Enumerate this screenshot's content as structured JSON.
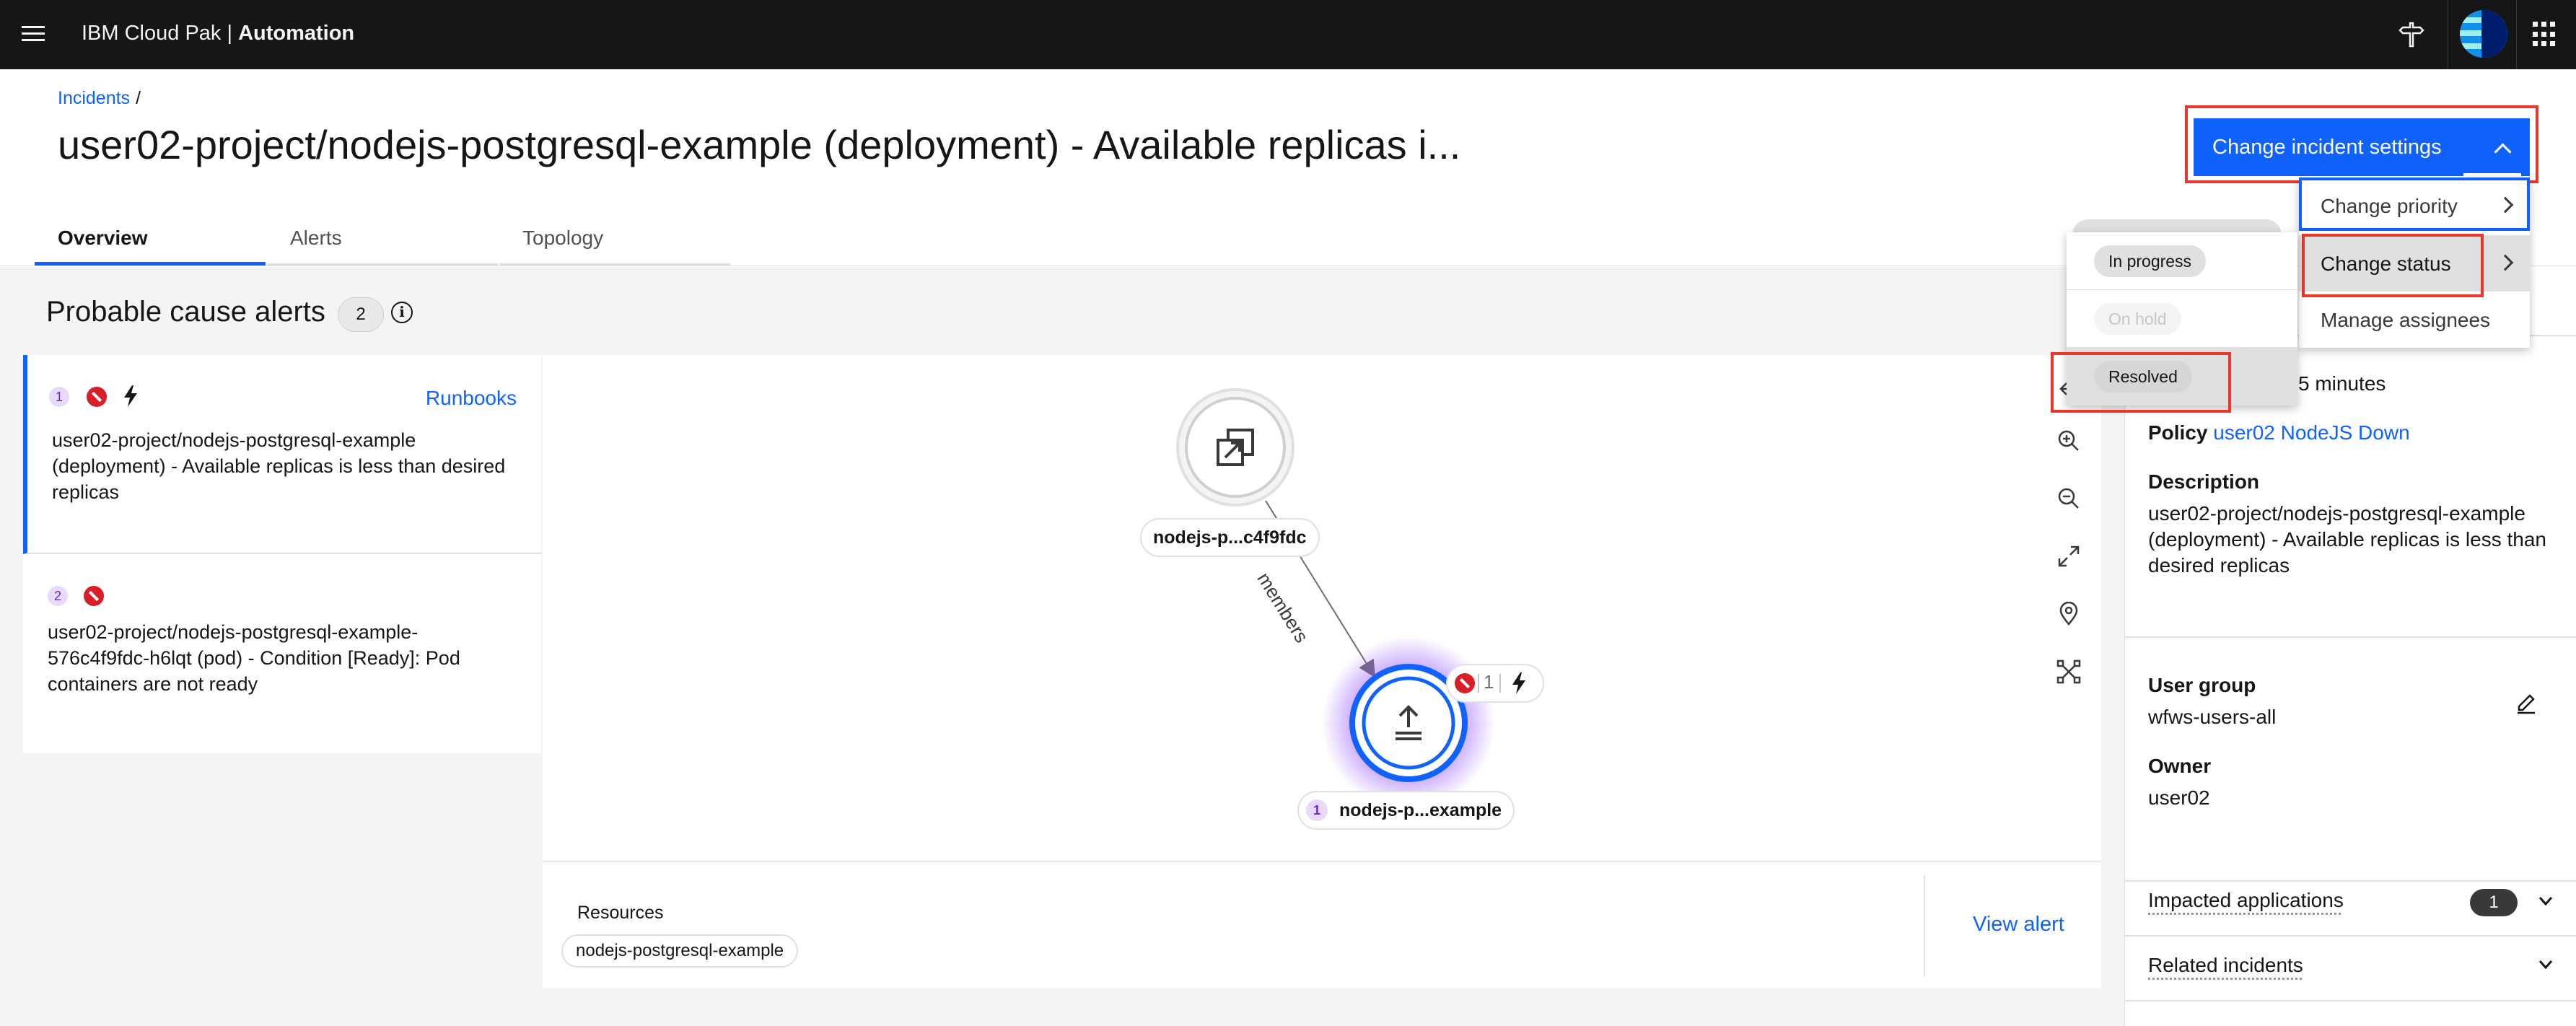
{
  "header": {
    "brand_prefix": "IBM Cloud Pak | ",
    "brand_product": "Automation"
  },
  "breadcrumb": {
    "incidents": "Incidents",
    "separator": "/"
  },
  "page_title": "user02-project/nodejs-postgresql-example (deployment) - Available replicas i...",
  "tabs": [
    {
      "label": "Overview",
      "active": true
    },
    {
      "label": "Alerts",
      "active": false
    },
    {
      "label": "Topology",
      "active": false
    }
  ],
  "settings_button": {
    "label": "Change incident settings"
  },
  "settings_menu": {
    "items": [
      {
        "label": "Change priority"
      },
      {
        "label": "Change status"
      },
      {
        "label": "Manage assignees"
      }
    ]
  },
  "status_submenu": {
    "items": [
      {
        "label": "In progress",
        "disabled": false
      },
      {
        "label": "On hold",
        "disabled": true
      },
      {
        "label": "Resolved",
        "disabled": false
      }
    ]
  },
  "probable_cause": {
    "title": "Probable cause alerts",
    "count": "2",
    "info": "i",
    "alerts": [
      {
        "rank": "1",
        "runbooks": "Runbooks",
        "text": "user02-project/nodejs-postgresql-example (deployment) - Available replicas is less than desired replicas"
      },
      {
        "rank": "2",
        "text": "user02-project/nodejs-postgresql-example-576c4f9fdc-h6lqt (pod) - Condition [Ready]: Pod containers are not ready"
      }
    ]
  },
  "topology": {
    "node_top_label": "nodejs-p...c4f9fdc",
    "edge_label": "members",
    "node_bottom_label": "nodejs-p...example",
    "node_bottom_rank": "1",
    "badge_count": "1"
  },
  "resources": {
    "label": "Resources",
    "tag": "nodejs-postgresql-example",
    "view_alert": "View alert"
  },
  "side_panel": {
    "duration_fragment": "5 minutes",
    "policy_label": "Policy",
    "policy_value": "user02 NodeJS Down",
    "description_label": "Description",
    "description": "user02-project/nodejs-postgresql-example (deployment) - Available replicas is less than desired replicas",
    "user_group_label": "User group",
    "user_group": "wfws-users-all",
    "owner_label": "Owner",
    "owner": "user02",
    "impacted_apps_label": "Impacted applications",
    "impacted_apps_count": "1",
    "related_incidents_label": "Related incidents"
  },
  "colors": {
    "accent": "#0f62fe",
    "header_bg": "#161616",
    "critical": "#da1e28",
    "annotation": "#e8372c"
  }
}
